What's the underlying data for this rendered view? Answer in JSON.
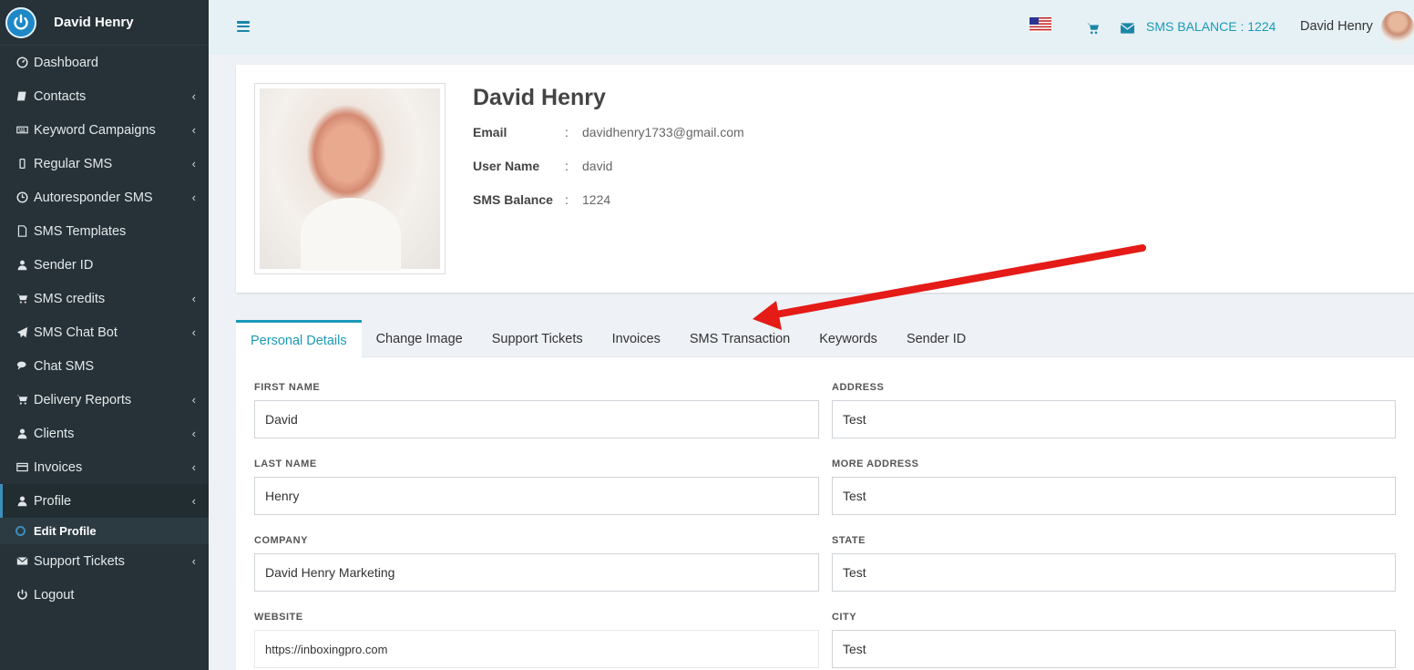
{
  "brand": {
    "name": "David Henry"
  },
  "sidebar": {
    "items": [
      {
        "label": "Dashboard",
        "icon": "dashboard-icon",
        "has_submenu": false
      },
      {
        "label": "Contacts",
        "icon": "book-icon",
        "has_submenu": true
      },
      {
        "label": "Keyword Campaigns",
        "icon": "keyboard-icon",
        "has_submenu": true
      },
      {
        "label": "Regular SMS",
        "icon": "mobile-icon",
        "has_submenu": true
      },
      {
        "label": "Autoresponder SMS",
        "icon": "clock-icon",
        "has_submenu": true
      },
      {
        "label": "SMS Templates",
        "icon": "file-icon",
        "has_submenu": false
      },
      {
        "label": "Sender ID",
        "icon": "user-secret-icon",
        "has_submenu": false
      },
      {
        "label": "SMS credits",
        "icon": "cart-icon",
        "has_submenu": true
      },
      {
        "label": "SMS Chat Bot",
        "icon": "paper-plane-icon",
        "has_submenu": true
      },
      {
        "label": "Chat SMS",
        "icon": "comments-icon",
        "has_submenu": false
      },
      {
        "label": "Delivery Reports",
        "icon": "cart-icon",
        "has_submenu": true
      },
      {
        "label": "Clients",
        "icon": "user-icon",
        "has_submenu": true
      },
      {
        "label": "Invoices",
        "icon": "credit-card-icon",
        "has_submenu": true
      },
      {
        "label": "Profile",
        "icon": "user-icon",
        "has_submenu": true,
        "active": true
      },
      {
        "label": "Support Tickets",
        "icon": "envelope-icon",
        "has_submenu": true
      },
      {
        "label": "Logout",
        "icon": "power-icon",
        "has_submenu": false
      }
    ],
    "subitem": {
      "label": "Edit Profile"
    },
    "chevron": "‹"
  },
  "header": {
    "sms_balance": "SMS BALANCE : 1224",
    "user_name": "David Henry",
    "accent_color": "#1a9ab8"
  },
  "profile": {
    "name": "David Henry",
    "rows": [
      {
        "key": "Email",
        "sep": ":",
        "value": "davidhenry1733@gmail.com"
      },
      {
        "key": "User Name",
        "sep": ":",
        "value": "david"
      },
      {
        "key": "SMS Balance",
        "sep": ":",
        "value": "1224"
      }
    ]
  },
  "tabs": [
    {
      "label": "Personal Details",
      "active": true
    },
    {
      "label": "Change Image"
    },
    {
      "label": "Support Tickets"
    },
    {
      "label": "Invoices"
    },
    {
      "label": "SMS Transaction"
    },
    {
      "label": "Keywords"
    },
    {
      "label": "Sender ID"
    }
  ],
  "form": {
    "first_name": {
      "label": "FIRST NAME",
      "value": "David"
    },
    "last_name": {
      "label": "LAST NAME",
      "value": "Henry"
    },
    "company": {
      "label": "COMPANY",
      "value": "David Henry Marketing"
    },
    "website": {
      "label": "WEBSITE",
      "value": "https://inboxingpro.com"
    },
    "address": {
      "label": "ADDRESS",
      "value": "Test"
    },
    "more_address": {
      "label": "MORE ADDRESS",
      "value": "Test"
    },
    "state": {
      "label": "STATE",
      "value": "Test"
    },
    "city": {
      "label": "CITY",
      "value": "Test"
    }
  }
}
